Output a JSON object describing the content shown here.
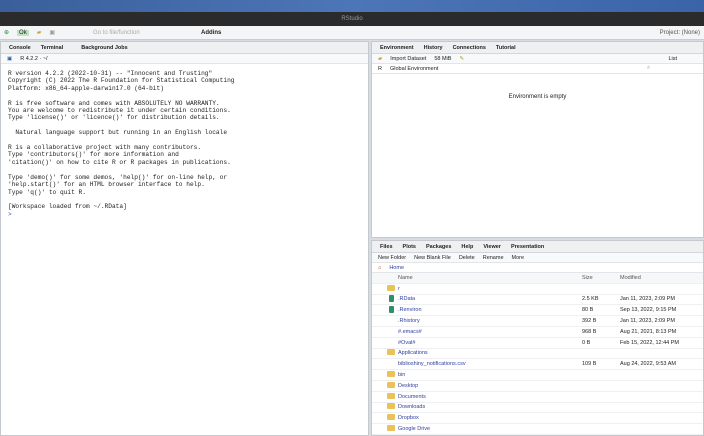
{
  "window": {
    "title": "RStudio"
  },
  "toolbar": {
    "goto_placeholder": "Go to file/function",
    "addins": "Addins",
    "project": "Project: (None)"
  },
  "left": {
    "tabs": [
      "Console",
      "Terminal",
      "Background Jobs"
    ],
    "r_version": "R 4.2.2 · ~/",
    "console_text": "R version 4.2.2 (2022-10-31) -- \"Innocent and Trusting\"\nCopyright (C) 2022 The R Foundation for Statistical Computing\nPlatform: x86_64-apple-darwin17.0 (64-bit)\n\nR is free software and comes with ABSOLUTELY NO WARRANTY.\nYou are welcome to redistribute it under certain conditions.\nType 'license()' or 'licence()' for distribution details.\n\n  Natural language support but running in an English locale\n\nR is a collaborative project with many contributors.\nType 'contributors()' for more information and\n'citation()' on how to cite R or R packages in publications.\n\nType 'demo()' for some demos, 'help()' for on-line help, or\n'help.start()' for an HTML browser interface to help.\nType 'q()' to quit R.\n\n[Workspace loaded from ~/.RData]\n",
    "prompt": ">"
  },
  "env": {
    "tabs": [
      "Environment",
      "History",
      "Connections",
      "Tutorial"
    ],
    "import": "Import Dataset",
    "memory": "58 MiB",
    "view": "List",
    "lang": "R",
    "scope": "Global Environment",
    "empty": "Environment is empty"
  },
  "files": {
    "tabs": [
      "Files",
      "Plots",
      "Packages",
      "Help",
      "Viewer",
      "Presentation"
    ],
    "actions": [
      "New Folder",
      "New Blank File",
      "Delete",
      "Rename",
      "More"
    ],
    "path": "Home",
    "headers": [
      "Name",
      "Size",
      "Modified"
    ],
    "rows": [
      {
        "name": "r",
        "size": "",
        "modified": "",
        "type": "folder"
      },
      {
        "name": ".RData",
        "size": "2.5 KB",
        "modified": "Jan 11, 2023, 2:09 PM",
        "type": "file"
      },
      {
        "name": ".Renviron",
        "size": "80 B",
        "modified": "Sep 13, 2022, 9:15 PM",
        "type": "file"
      },
      {
        "name": ".Rhistory",
        "size": "392 B",
        "modified": "Jan 11, 2023, 2:09 PM",
        "type": "doc"
      },
      {
        "name": "#.emacs#",
        "size": "968 B",
        "modified": "Aug 21, 2021, 8:13 PM",
        "type": "doc"
      },
      {
        "name": "#Oval#",
        "size": "0 B",
        "modified": "Feb 15, 2022, 12:44 PM",
        "type": "doc"
      },
      {
        "name": "Applications",
        "size": "",
        "modified": "",
        "type": "folder"
      },
      {
        "name": "biblioshiny_notifications.csv",
        "size": "109 B",
        "modified": "Aug 24, 2022, 9:53 AM",
        "type": "doc"
      },
      {
        "name": "bin",
        "size": "",
        "modified": "",
        "type": "folder"
      },
      {
        "name": "Desktop",
        "size": "",
        "modified": "",
        "type": "folder"
      },
      {
        "name": "Documents",
        "size": "",
        "modified": "",
        "type": "folder"
      },
      {
        "name": "Downloads",
        "size": "",
        "modified": "",
        "type": "folder"
      },
      {
        "name": "Dropbox",
        "size": "",
        "modified": "",
        "type": "folder"
      },
      {
        "name": "Google Drive",
        "size": "",
        "modified": "",
        "type": "folder"
      }
    ]
  }
}
